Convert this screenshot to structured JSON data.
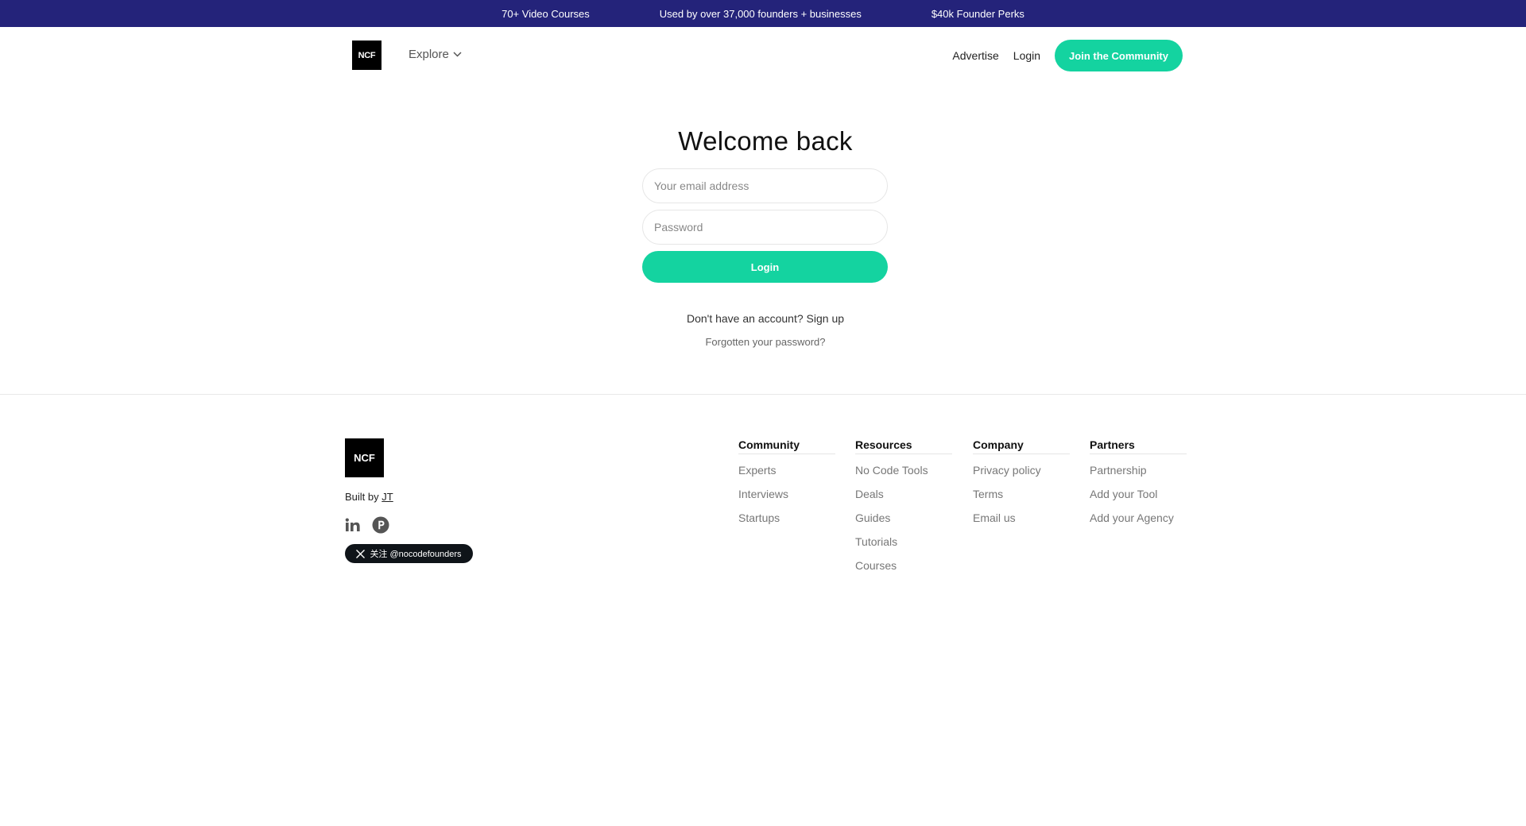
{
  "topbar": {
    "items": [
      "70+ Video Courses",
      "Used by over 37,000 founders + businesses",
      "$40k Founder Perks"
    ],
    "bg_color": "#24237a"
  },
  "nav": {
    "logo_text": "NCF",
    "explore_label": "Explore",
    "advertise_label": "Advertise",
    "login_label": "Login",
    "join_label": "Join the Community",
    "accent_color": "#14d3a0"
  },
  "login": {
    "title": "Welcome back",
    "email_placeholder": "Your email address",
    "password_placeholder": "Password",
    "submit_label": "Login",
    "signup_prefix": "Don't have an account?",
    "signup_link": "Sign up",
    "forgot_label": "Forgotten your password?"
  },
  "footer": {
    "logo_text": "NCF",
    "built_prefix": "Built by",
    "built_author": "JT",
    "social_icons": [
      "linkedin-icon",
      "producthunt-icon"
    ],
    "follow_label": "关注 @nocodefounders",
    "columns": [
      {
        "title": "Community",
        "links": [
          "Experts",
          "Interviews",
          "Startups"
        ]
      },
      {
        "title": "Resources",
        "links": [
          "No Code Tools",
          "Deals",
          "Guides",
          "Tutorials",
          "Courses"
        ]
      },
      {
        "title": "Company",
        "links": [
          "Privacy policy",
          "Terms",
          "Email us"
        ]
      },
      {
        "title": "Partners",
        "links": [
          "Partnership",
          "Add your Tool",
          "Add your Agency"
        ]
      }
    ]
  }
}
